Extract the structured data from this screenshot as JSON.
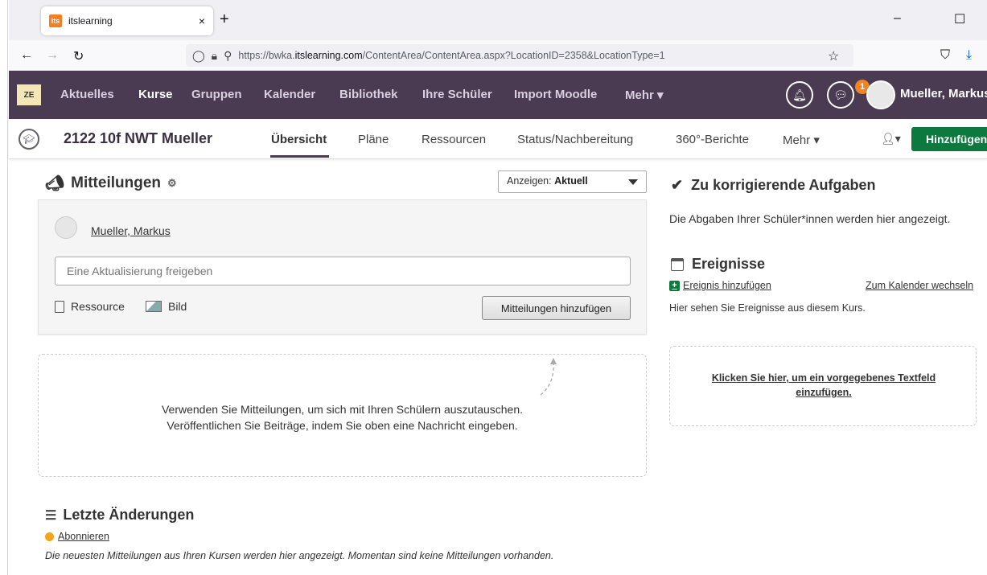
{
  "browser": {
    "tab_title": "itslearning",
    "tab_favicon": "its",
    "tab_close": "×",
    "new_tab": "+",
    "minimize": "–",
    "maximize": "☐",
    "url_prefix": "https://bwka.",
    "url_host": "itslearning.com",
    "url_path": "/ContentArea/ContentArea.aspx?LocationID=2358&LocationType=1"
  },
  "mainnav": {
    "logo_text": "ZE",
    "items": [
      "Aktuelles",
      "Kurse",
      "Gruppen",
      "Kalender",
      "Bibliothek",
      "Ihre Schüler",
      "Import Moodle",
      "Mehr ▾"
    ],
    "active_index": 1,
    "message_badge": "1",
    "user_name": "Mueller, Markus"
  },
  "coursebar": {
    "title": "2122 10f NWT Mueller",
    "tabs": [
      "Übersicht",
      "Pläne",
      "Ressourcen",
      "Status/Nachbereitung",
      "360°-Berichte",
      "Mehr ▾"
    ],
    "active_index": 0,
    "person_dropdown": "▾",
    "add_button": "Hinzufügen"
  },
  "mitteilungen": {
    "heading": "Mitteilungen",
    "filter_label": "Anzeigen: ",
    "filter_value": "Aktuell",
    "author": "Mueller, Markus",
    "input_placeholder": "Eine Aktualisierung freigeben",
    "attach_resource": "Ressource",
    "attach_image": "Bild",
    "post_button": "Mitteilungen hinzufügen",
    "empty_line1": "Verwenden Sie Mitteilungen, um sich mit Ihren Schülern auszutauschen.",
    "empty_line2": "Veröffentlichen Sie Beiträge, indem Sie oben eine Nachricht eingeben."
  },
  "letzte": {
    "heading": "Letzte Änderungen",
    "subscribe": "Abonnieren",
    "note": "Die neuesten Mitteilungen aus Ihren Kursen werden hier angezeigt. Momentan sind keine Mitteilungen vorhanden."
  },
  "aufgaben": {
    "heading": "Zu korrigierende Aufgaben",
    "text": "Die Abgaben Ihrer Schüler*innen werden hier angezeigt."
  },
  "ereignisse": {
    "heading": "Ereignisse",
    "add_link": "Ereignis hinzufügen",
    "calendar_link": "Zum Kalender wechseln",
    "text": "Hier sehen Sie Ereignisse aus diesem Kurs.",
    "textbox_link": "Klicken Sie hier, um ein vorgegebenes Textfeld einzufügen."
  },
  "colors": {
    "nav_purple": "#4a3a52",
    "add_green": "#0c7a3e",
    "badge_orange": "#f58220"
  }
}
